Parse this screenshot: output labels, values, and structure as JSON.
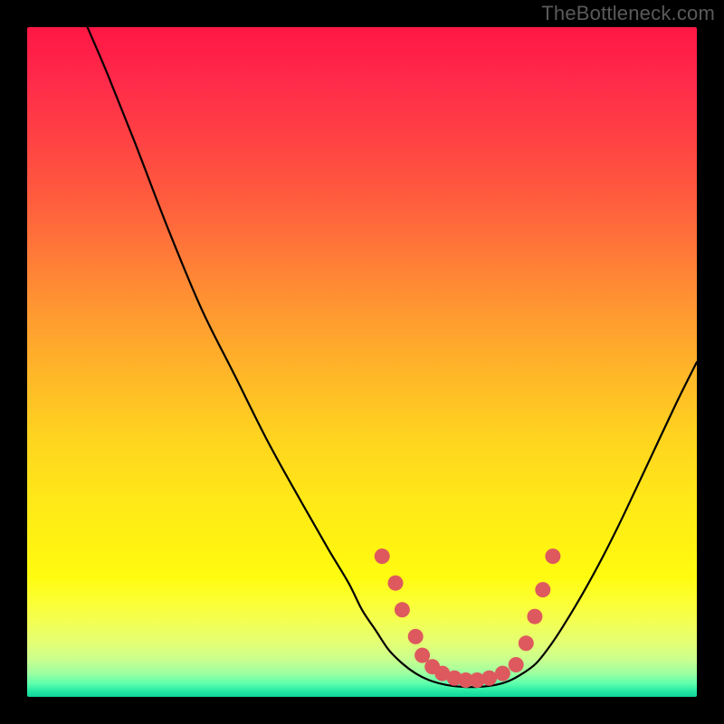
{
  "attribution": "TheBottleneck.com",
  "chart_data": {
    "type": "line",
    "title": "",
    "xlabel": "",
    "ylabel": "",
    "xlim": [
      0,
      1
    ],
    "ylim": [
      0,
      1
    ],
    "curve": [
      {
        "x": 0.09,
        "y": 1.0
      },
      {
        "x": 0.12,
        "y": 0.93
      },
      {
        "x": 0.16,
        "y": 0.83
      },
      {
        "x": 0.21,
        "y": 0.7
      },
      {
        "x": 0.26,
        "y": 0.58
      },
      {
        "x": 0.31,
        "y": 0.48
      },
      {
        "x": 0.36,
        "y": 0.38
      },
      {
        "x": 0.41,
        "y": 0.29
      },
      {
        "x": 0.45,
        "y": 0.22
      },
      {
        "x": 0.48,
        "y": 0.17
      },
      {
        "x": 0.5,
        "y": 0.13
      },
      {
        "x": 0.52,
        "y": 0.1
      },
      {
        "x": 0.54,
        "y": 0.07
      },
      {
        "x": 0.56,
        "y": 0.05
      },
      {
        "x": 0.58,
        "y": 0.035
      },
      {
        "x": 0.6,
        "y": 0.025
      },
      {
        "x": 0.625,
        "y": 0.018
      },
      {
        "x": 0.65,
        "y": 0.015
      },
      {
        "x": 0.675,
        "y": 0.015
      },
      {
        "x": 0.7,
        "y": 0.018
      },
      {
        "x": 0.72,
        "y": 0.024
      },
      {
        "x": 0.74,
        "y": 0.035
      },
      {
        "x": 0.76,
        "y": 0.05
      },
      {
        "x": 0.78,
        "y": 0.075
      },
      {
        "x": 0.8,
        "y": 0.105
      },
      {
        "x": 0.83,
        "y": 0.155
      },
      {
        "x": 0.86,
        "y": 0.21
      },
      {
        "x": 0.89,
        "y": 0.27
      },
      {
        "x": 0.93,
        "y": 0.355
      },
      {
        "x": 0.97,
        "y": 0.44
      },
      {
        "x": 1.0,
        "y": 0.5
      }
    ],
    "markers": [
      {
        "x": 0.53,
        "y": 0.21
      },
      {
        "x": 0.55,
        "y": 0.17
      },
      {
        "x": 0.56,
        "y": 0.13
      },
      {
        "x": 0.58,
        "y": 0.09
      },
      {
        "x": 0.59,
        "y": 0.062
      },
      {
        "x": 0.605,
        "y": 0.045
      },
      {
        "x": 0.62,
        "y": 0.035
      },
      {
        "x": 0.638,
        "y": 0.028
      },
      {
        "x": 0.655,
        "y": 0.025
      },
      {
        "x": 0.672,
        "y": 0.025
      },
      {
        "x": 0.69,
        "y": 0.028
      },
      {
        "x": 0.71,
        "y": 0.035
      },
      {
        "x": 0.73,
        "y": 0.048
      },
      {
        "x": 0.745,
        "y": 0.08
      },
      {
        "x": 0.758,
        "y": 0.12
      },
      {
        "x": 0.77,
        "y": 0.16
      },
      {
        "x": 0.785,
        "y": 0.21
      }
    ]
  }
}
